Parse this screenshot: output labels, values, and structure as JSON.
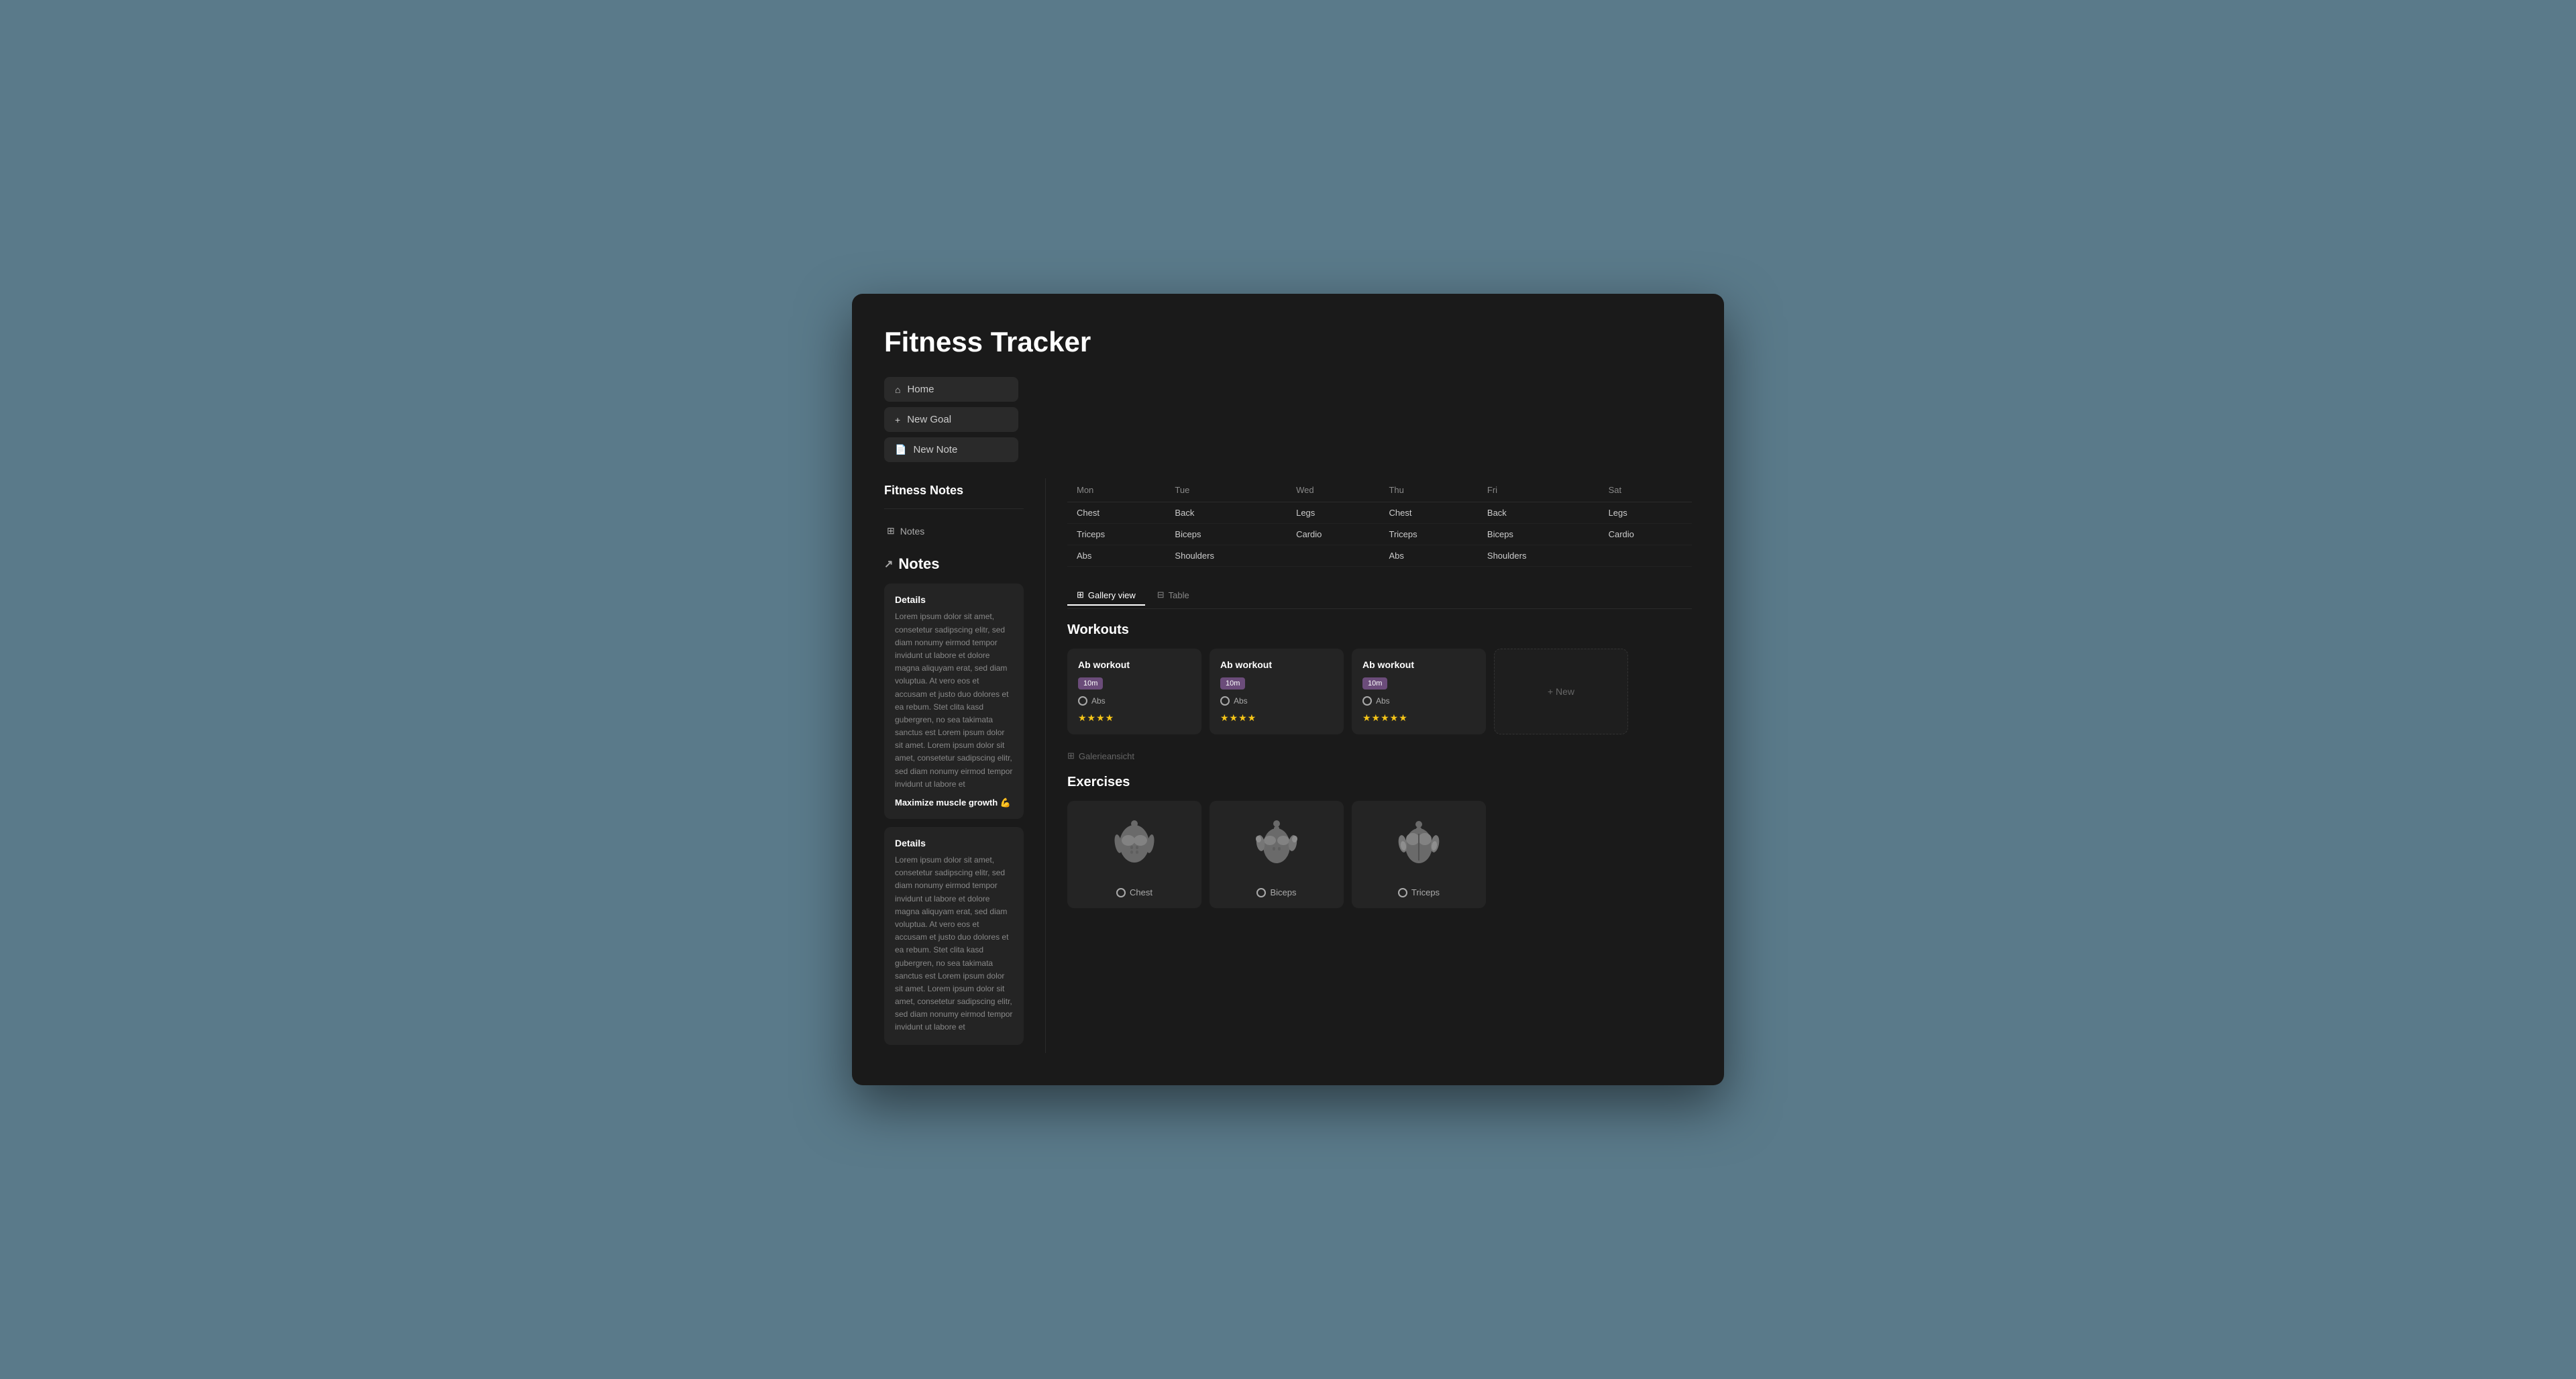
{
  "app": {
    "title": "Fitness Tracker",
    "background_color": "#5a7a8a"
  },
  "nav": {
    "home_label": "Home",
    "new_goal_label": "New Goal",
    "new_note_label": "New Note"
  },
  "sidebar": {
    "fitness_notes_title": "Fitness Notes",
    "notes_item_label": "Notes",
    "notes_heading": "Notes",
    "note1": {
      "title": "Details",
      "body": "Lorem ipsum dolor sit amet, consetetur sadipscing elitr, sed diam nonumy eirmod tempor invidunt ut labore et dolore magna aliquyam erat, sed diam voluptua. At vero eos et accusam et justo duo dolores et ea rebum. Stet clita kasd gubergren, no sea takimata sanctus est Lorem ipsum dolor sit amet. Lorem ipsum dolor sit amet, consetetur sadipscing elitr, sed diam nonumy eirmod tempor invidunt ut labore et",
      "highlight": "Maximize muscle growth 💪"
    },
    "note2": {
      "title": "Details",
      "body": "Lorem ipsum dolor sit amet, consetetur sadipscing elitr, sed diam nonumy eirmod tempor invidunt ut labore et dolore magna aliquyam erat, sed diam voluptua. At vero eos et accusam et justo duo dolores et ea rebum. Stet clita kasd gubergren, no sea takimata sanctus est Lorem ipsum dolor sit amet. Lorem ipsum dolor sit amet, consetetur sadipscing elitr, sed diam nonumy eirmod tempor invidunt ut labore et"
    }
  },
  "schedule": {
    "days": [
      "Mon",
      "Tue",
      "Wed",
      "Thu",
      "Fri",
      "Sat"
    ],
    "row1": [
      "Chest",
      "Back",
      "Legs",
      "Chest",
      "Back",
      "Legs"
    ],
    "row2": [
      "Triceps",
      "Biceps",
      "Cardio",
      "Triceps",
      "Biceps",
      "Cardio"
    ],
    "row3": [
      "Abs",
      "Shoulders",
      "",
      "Abs",
      "Shoulders",
      ""
    ]
  },
  "views": {
    "gallery_label": "Gallery view",
    "table_label": "Table"
  },
  "workouts": {
    "heading": "Workouts",
    "cards": [
      {
        "title": "Ab workout",
        "duration": "10m",
        "muscle": "Abs",
        "stars": "★★★★"
      },
      {
        "title": "Ab workout",
        "duration": "10m",
        "muscle": "Abs",
        "stars": "★★★★"
      },
      {
        "title": "Ab workout",
        "duration": "10m",
        "muscle": "Abs",
        "stars": "★★★★★"
      }
    ],
    "new_label": "+ New"
  },
  "gallery_view_label": "Galerieansicht",
  "exercises": {
    "heading": "Exercises",
    "cards": [
      {
        "name": "Chest"
      },
      {
        "name": "Biceps"
      },
      {
        "name": "Triceps"
      }
    ]
  }
}
